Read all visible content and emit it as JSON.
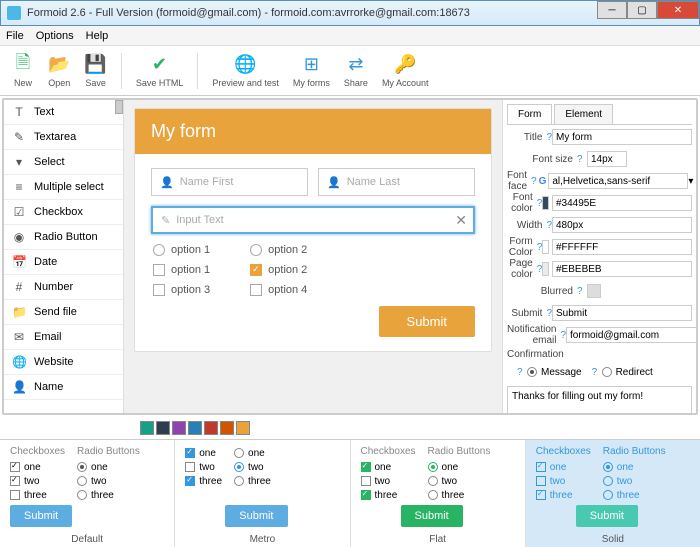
{
  "window": {
    "title": "Formoid 2.6 - Full Version (formoid@gmail.com) - formoid.com:avrrorke@gmail.com:18673"
  },
  "menu": {
    "file": "File",
    "options": "Options",
    "help": "Help"
  },
  "toolbar": {
    "new": "New",
    "open": "Open",
    "save": "Save",
    "savehtml": "Save HTML",
    "preview": "Preview and test",
    "myforms": "My forms",
    "share": "Share",
    "account": "My Account"
  },
  "sidebar": {
    "items": [
      {
        "icon": "T",
        "label": "Text"
      },
      {
        "icon": "✎",
        "label": "Textarea"
      },
      {
        "icon": "▾",
        "label": "Select"
      },
      {
        "icon": "≡",
        "label": "Multiple select"
      },
      {
        "icon": "☑",
        "label": "Checkbox"
      },
      {
        "icon": "◉",
        "label": "Radio Button"
      },
      {
        "icon": "📅",
        "label": "Date"
      },
      {
        "icon": "#",
        "label": "Number"
      },
      {
        "icon": "📁",
        "label": "Send file"
      },
      {
        "icon": "✉",
        "label": "Email"
      },
      {
        "icon": "🌐",
        "label": "Website"
      },
      {
        "icon": "👤",
        "label": "Name"
      }
    ]
  },
  "form": {
    "title": "My form",
    "name_first": "Name First",
    "name_last": "Name Last",
    "input_text": "Input Text",
    "radio1": "option 1",
    "radio2": "option 2",
    "check1": "option 1",
    "check2": "option 2",
    "check3": "option 3",
    "check4": "option 4",
    "submit": "Submit"
  },
  "props": {
    "tab_form": "Form",
    "tab_element": "Element",
    "title_l": "Title",
    "title_v": "My form",
    "fontsize_l": "Font size",
    "fontsize_v": "14px",
    "fontface_l": "Font face",
    "fontface_v": "al,Helvetica,sans-serif",
    "fontcolor_l": "Font color",
    "fontcolor_v": "#34495E",
    "width_l": "Width",
    "width_v": "480px",
    "formcolor_l": "Form Color",
    "formcolor_v": "#FFFFFF",
    "pagecolor_l": "Page color",
    "pagecolor_v": "#EBEBEB",
    "blurred_l": "Blurred",
    "submit_l": "Submit",
    "submit_v": "Submit",
    "email_l": "Notification email",
    "email_v": "formoid@gmail.com",
    "confirm_l": "Confirmation",
    "message": "Message",
    "redirect": "Redirect",
    "confirm_text": "Thanks for filling out my form!"
  },
  "swatches": [
    "#16a085",
    "#2c3e50",
    "#8e44ad",
    "#2980b9",
    "#c0392b",
    "#d35400",
    "#e8a33d"
  ],
  "themes": {
    "cb_title": "Checkboxes",
    "rb_title": "Radio Buttons",
    "one": "one",
    "two": "two",
    "three": "three",
    "submit": "Submit",
    "default": "Default",
    "metro": "Metro",
    "flat": "Flat",
    "solid": "Solid"
  }
}
